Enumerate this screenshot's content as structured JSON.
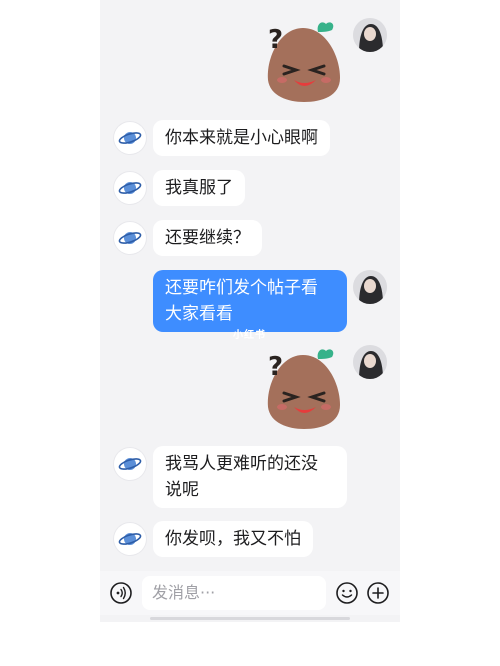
{
  "messages": [
    {
      "side": "left",
      "text": "你本来就是小心眼啊"
    },
    {
      "side": "left",
      "text": "我真服了"
    },
    {
      "side": "left",
      "text": "还要继续？"
    },
    {
      "side": "right",
      "line1": "还要咋们发个帖子看",
      "line2": "大家看看"
    },
    {
      "side": "left",
      "line1": "我骂人更难听的还没",
      "line2": "说呢"
    },
    {
      "side": "left",
      "text": "你发呗，我又不怕"
    }
  ],
  "watermark": "小红书",
  "input": {
    "placeholder": "发消息···"
  },
  "icons": {
    "left_avatar": "planet-icon",
    "right_avatar": "profile-photo",
    "sticker": "angry-mole-sticker",
    "voice": "voice-icon",
    "emoji": "emoji-icon",
    "plus": "plus-icon"
  },
  "colors": {
    "bubble_right": "#3e8dff",
    "bubble_left": "#ffffff",
    "background": "#f3f3f5"
  }
}
